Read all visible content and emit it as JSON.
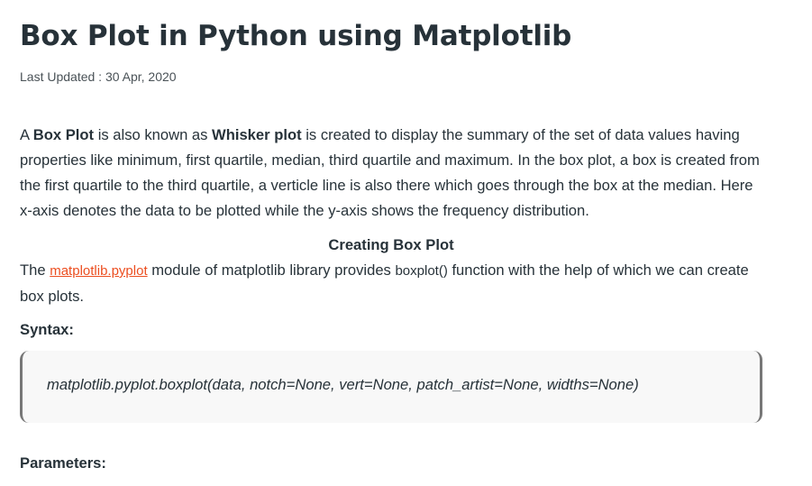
{
  "article": {
    "title": "Box Plot in Python using Matplotlib",
    "last_updated": "Last Updated : 30 Apr, 2020"
  },
  "intro": {
    "t1": "A ",
    "b1": "Box Plot",
    "t2": " is also known as ",
    "b2": "Whisker plot",
    "t3": " is created to display the summary of the set of data values having properties like minimum, first quartile, median, third quartile and maximum. In the box plot, a box is created from the first quartile to the third quartile, a verticle line is also there which goes through the box at the median. Here x-axis denotes the data to be plotted while the y-axis shows the frequency distribution."
  },
  "creating_section": {
    "heading": "Creating Box Plot",
    "t1": "The ",
    "link": "matplotlib.pyplot",
    "t2": " module of matplotlib library provides ",
    "code": "boxplot()",
    "t3": " function with the help of which we can create box plots."
  },
  "syntax": {
    "label": "Syntax:",
    "code": "matplotlib.pyplot.boxplot(data, notch=None, vert=None, patch_artist=None, widths=None)"
  },
  "parameters": {
    "label": "Parameters:"
  },
  "colors": {
    "text": "#273239",
    "link": "#ec4e20",
    "code_bg": "#f8f8f8",
    "code_border": "#777777"
  }
}
